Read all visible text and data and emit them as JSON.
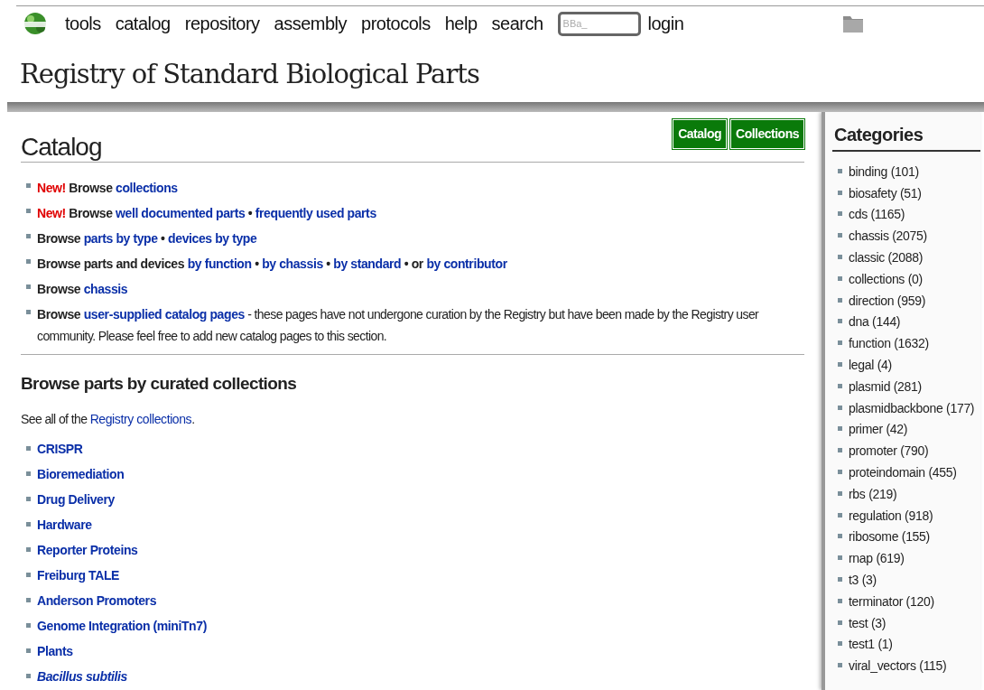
{
  "nav": {
    "links": [
      "tools",
      "catalog",
      "repository",
      "assembly",
      "protocols",
      "help",
      "search"
    ],
    "search": {
      "placeholder": "BBa_"
    },
    "login": "login"
  },
  "site_title": "Registry of Standard Biological Parts",
  "main": {
    "title": "Catalog",
    "buttons": [
      "Catalog",
      "Collections"
    ],
    "catalog_items": [
      [
        {
          "kind": "new",
          "text": "New!"
        },
        {
          "kind": "text",
          "text": " Browse "
        },
        {
          "kind": "link",
          "text": "collections"
        }
      ],
      [
        {
          "kind": "new",
          "text": "New!"
        },
        {
          "kind": "text",
          "text": " Browse "
        },
        {
          "kind": "link",
          "text": "well documented parts"
        },
        {
          "kind": "text",
          "text": " • "
        },
        {
          "kind": "link",
          "text": "frequently used parts"
        }
      ],
      [
        {
          "kind": "text",
          "text": "Browse "
        },
        {
          "kind": "link",
          "text": "parts by type"
        },
        {
          "kind": "text",
          "text": " • "
        },
        {
          "kind": "link",
          "text": "devices by type"
        }
      ],
      [
        {
          "kind": "text",
          "text": "Browse parts and devices "
        },
        {
          "kind": "link",
          "text": "by function"
        },
        {
          "kind": "text",
          "text": " • "
        },
        {
          "kind": "link",
          "text": "by chassis"
        },
        {
          "kind": "text",
          "text": " • "
        },
        {
          "kind": "link",
          "text": "by standard"
        },
        {
          "kind": "text",
          "text": " • or "
        },
        {
          "kind": "link",
          "text": "by contributor"
        }
      ],
      [
        {
          "kind": "text",
          "text": "Browse "
        },
        {
          "kind": "link",
          "text": "chassis"
        }
      ],
      [
        {
          "kind": "text",
          "text": "Browse "
        },
        {
          "kind": "link",
          "text": "user-supplied catalog pages"
        },
        {
          "kind": "plain",
          "text": " - these pages have not undergone curation by the Registry but have been made by the Registry user community. Please feel free to add new catalog pages to this section."
        }
      ]
    ],
    "collections_heading": "Browse parts by curated collections",
    "collections_intro": [
      {
        "kind": "plain",
        "text": "See all of the "
      },
      {
        "kind": "link",
        "text": "Registry collections"
      },
      {
        "kind": "plain",
        "text": "."
      }
    ],
    "collections": [
      {
        "text": "CRISPR",
        "italic": false
      },
      {
        "text": "Bioremediation",
        "italic": false
      },
      {
        "text": "Drug Delivery",
        "italic": false
      },
      {
        "text": "Hardware",
        "italic": false
      },
      {
        "text": "Reporter Proteins",
        "italic": false
      },
      {
        "text": "Freiburg TALE",
        "italic": false
      },
      {
        "text": "Anderson Promoters",
        "italic": false
      },
      {
        "text": "Genome Integration (miniTn7)",
        "italic": false
      },
      {
        "text": "Plants",
        "italic": false
      },
      {
        "text": "Bacillus subtilis",
        "italic": true
      }
    ]
  },
  "sidebar": {
    "title": "Categories",
    "items": [
      "binding (101)",
      "biosafety (51)",
      "cds (1165)",
      "chassis (2075)",
      "classic (2088)",
      "collections (0)",
      "direction (959)",
      "dna (144)",
      "function (1632)",
      "legal (4)",
      "plasmid (281)",
      "plasmidbackbone (177)",
      "primer (42)",
      "promoter (790)",
      "proteindomain (455)",
      "rbs (219)",
      "regulation (918)",
      "ribosome (155)",
      "rnap (619)",
      "t3 (3)",
      "terminator (120)",
      "test (3)",
      "test1 (1)",
      "viral_vectors (115)"
    ]
  }
}
